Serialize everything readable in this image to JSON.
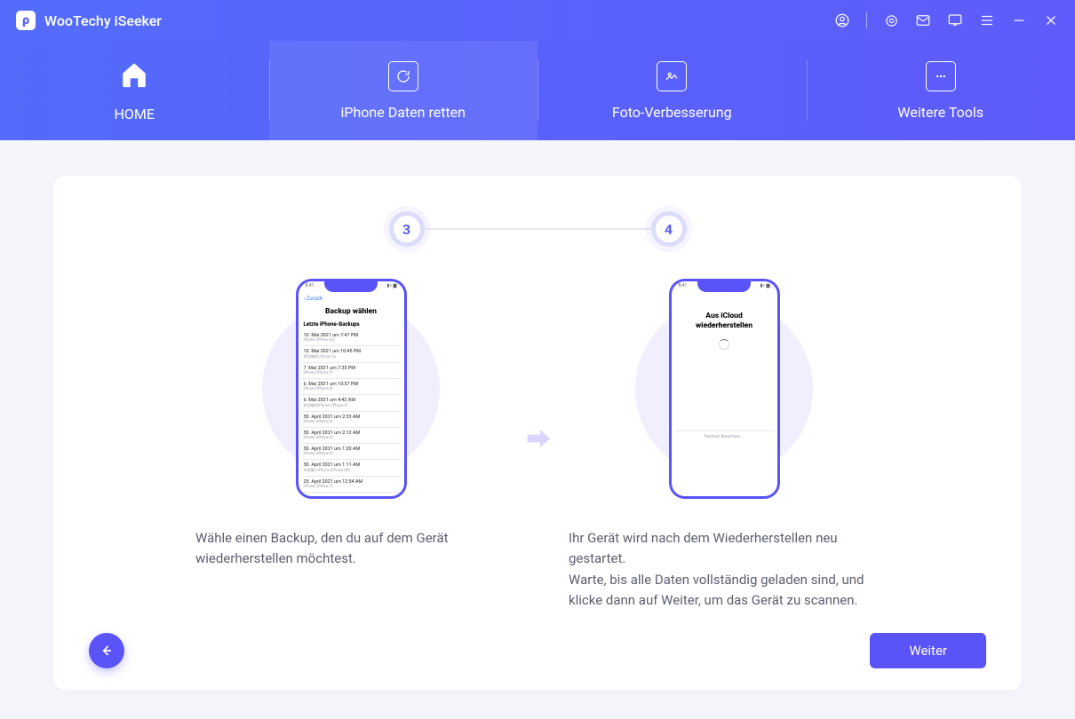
{
  "app": {
    "title": "WooTechy iSeeker",
    "logo_letter": "ρ"
  },
  "nav": [
    {
      "label": "HOME"
    },
    {
      "label": "iPhone Daten retten"
    },
    {
      "label": "Foto-Verbesserung"
    },
    {
      "label": "Weitere Tools"
    }
  ],
  "steps": {
    "a": "3",
    "b": "4"
  },
  "phone1": {
    "status_left": "8:41",
    "back_label": "Zurück",
    "title": "Backup wählen",
    "subheader": "Letzte iPhone-Backups",
    "rows": [
      {
        "r1": "10. Mai 2021 um 7:47 PM",
        "r2": "iPhone (iPhone 6s)"
      },
      {
        "r1": "10. Mai 2021 um 10:45 PM",
        "r2": "李思敏的 iPhone 5s"
      },
      {
        "r1": "7. Mai 2021 um 7:35 PM",
        "r2": "iPhone (iPhone 7)"
      },
      {
        "r1": "6. Mai 2021 um 10:57 PM",
        "r2": "iPhone (iPhone 8)"
      },
      {
        "r1": "6. Mai 2021 um 4:42 AM",
        "r2": "李思敏的iPhone (iPhone 6)"
      },
      {
        "r1": "30. April 2021 um 2:33 AM",
        "r2": "iPhone (iPhone 6)"
      },
      {
        "r1": "30. April 2021 um 2:12 AM",
        "r2": "iPhone (iPhone X)"
      },
      {
        "r1": "30. April 2021 um 1:20 AM",
        "r2": "iPhone (iPhone X)"
      },
      {
        "r1": "30. April 2021 um 1:11 AM",
        "r2": "李思敏's iPhone (iPhone XR)"
      },
      {
        "r1": "25. April 2021 um 12:54 AM",
        "r2": "iPhone (iPhone 7)"
      }
    ]
  },
  "phone2": {
    "status_left": "8:41",
    "title_l1": "Aus iCloud",
    "title_l2": "wiederherstellen",
    "sub": "Restzeit: Berechnen..."
  },
  "captions": {
    "left": "Wähle einen Backup, den du auf dem Gerät wiederherstellen möchtest.",
    "right": "Ihr Gerät wird nach dem Wiederherstellen neu gestartet.\nWarte, bis alle Daten vollständig geladen sind, und klicke dann auf Weiter, um das Gerät zu scannen."
  },
  "buttons": {
    "next": "Weiter"
  }
}
